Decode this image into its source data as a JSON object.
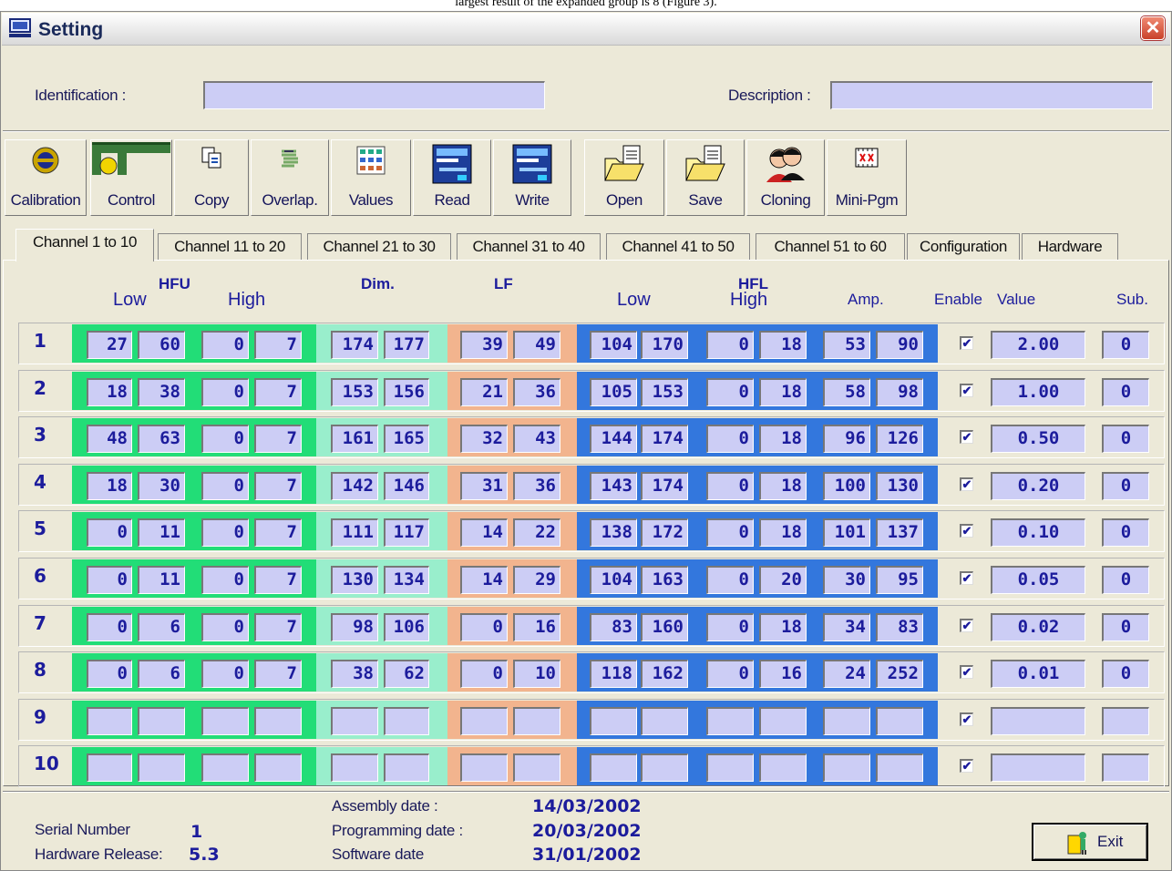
{
  "top_caption": "largest result of the expanded group is 8 (Figure 3).",
  "window": {
    "title": "Setting",
    "close_glyph": "✕"
  },
  "identification": {
    "label": "Identification :",
    "value": ""
  },
  "description": {
    "label": "Description :",
    "value": ""
  },
  "toolbar": [
    {
      "label": "Calibration",
      "icon": "calibration-icon"
    },
    {
      "label": "Control",
      "icon": "caliper-icon"
    },
    {
      "label": "Copy",
      "icon": "copy-icon"
    },
    {
      "label": "Overlap.",
      "icon": "overlap-icon"
    },
    {
      "label": "Values",
      "icon": "values-icon"
    },
    {
      "label": "Read",
      "icon": "read-icon"
    },
    {
      "label": "Write",
      "icon": "write-icon"
    },
    {
      "label": "Open",
      "icon": "open-folder-icon"
    },
    {
      "label": "Save",
      "icon": "save-folder-icon"
    },
    {
      "label": "Cloning",
      "icon": "cloning-icon"
    },
    {
      "label": "Mini-Pgm",
      "icon": "film-icon"
    }
  ],
  "tabs": [
    "Channel 1 to 10",
    "Channel 11 to 20",
    "Channel 21 to 30",
    "Channel 31 to 40",
    "Channel 41 to 50",
    "Channel 51 to 60",
    "Configuration",
    "Hardware"
  ],
  "active_tab": 0,
  "headers": {
    "hfu": "HFU",
    "hfu_low": "Low",
    "hfu_high": "High",
    "dim": "Dim.",
    "lf": "LF",
    "hfl": "HFL",
    "hfl_low": "Low",
    "hfl_high": "High",
    "amp": "Amp.",
    "enable": "Enable",
    "value": "Value",
    "sub": "Sub."
  },
  "colors": {
    "hfu": "#22dd77",
    "dim": "#99eecc",
    "lf": "#f2b48e",
    "hfl": "#3377dd",
    "field": "#cccdf5",
    "text": "#1c1c9c"
  },
  "channels": [
    {
      "n": "1",
      "hfu_low": [
        "27",
        "60"
      ],
      "hfu_high": [
        "0",
        "7"
      ],
      "dim": [
        "174",
        "177"
      ],
      "lf": [
        "39",
        "49"
      ],
      "hfl_low": [
        "104",
        "170"
      ],
      "hfl_high": [
        "0",
        "18"
      ],
      "amp": [
        "53",
        "90"
      ],
      "enabled": true,
      "value": "2.00",
      "sub": "0"
    },
    {
      "n": "2",
      "hfu_low": [
        "18",
        "38"
      ],
      "hfu_high": [
        "0",
        "7"
      ],
      "dim": [
        "153",
        "156"
      ],
      "lf": [
        "21",
        "36"
      ],
      "hfl_low": [
        "105",
        "153"
      ],
      "hfl_high": [
        "0",
        "18"
      ],
      "amp": [
        "58",
        "98"
      ],
      "enabled": true,
      "value": "1.00",
      "sub": "0"
    },
    {
      "n": "3",
      "hfu_low": [
        "48",
        "63"
      ],
      "hfu_high": [
        "0",
        "7"
      ],
      "dim": [
        "161",
        "165"
      ],
      "lf": [
        "32",
        "43"
      ],
      "hfl_low": [
        "144",
        "174"
      ],
      "hfl_high": [
        "0",
        "18"
      ],
      "amp": [
        "96",
        "126"
      ],
      "enabled": true,
      "value": "0.50",
      "sub": "0"
    },
    {
      "n": "4",
      "hfu_low": [
        "18",
        "30"
      ],
      "hfu_high": [
        "0",
        "7"
      ],
      "dim": [
        "142",
        "146"
      ],
      "lf": [
        "31",
        "36"
      ],
      "hfl_low": [
        "143",
        "174"
      ],
      "hfl_high": [
        "0",
        "18"
      ],
      "amp": [
        "100",
        "130"
      ],
      "enabled": true,
      "value": "0.20",
      "sub": "0"
    },
    {
      "n": "5",
      "hfu_low": [
        "0",
        "11"
      ],
      "hfu_high": [
        "0",
        "7"
      ],
      "dim": [
        "111",
        "117"
      ],
      "lf": [
        "14",
        "22"
      ],
      "hfl_low": [
        "138",
        "172"
      ],
      "hfl_high": [
        "0",
        "18"
      ],
      "amp": [
        "101",
        "137"
      ],
      "enabled": true,
      "value": "0.10",
      "sub": "0"
    },
    {
      "n": "6",
      "hfu_low": [
        "0",
        "11"
      ],
      "hfu_high": [
        "0",
        "7"
      ],
      "dim": [
        "130",
        "134"
      ],
      "lf": [
        "14",
        "29"
      ],
      "hfl_low": [
        "104",
        "163"
      ],
      "hfl_high": [
        "0",
        "20"
      ],
      "amp": [
        "30",
        "95"
      ],
      "enabled": true,
      "value": "0.05",
      "sub": "0"
    },
    {
      "n": "7",
      "hfu_low": [
        "0",
        "6"
      ],
      "hfu_high": [
        "0",
        "7"
      ],
      "dim": [
        "98",
        "106"
      ],
      "lf": [
        "0",
        "16"
      ],
      "hfl_low": [
        "83",
        "160"
      ],
      "hfl_high": [
        "0",
        "18"
      ],
      "amp": [
        "34",
        "83"
      ],
      "enabled": true,
      "value": "0.02",
      "sub": "0"
    },
    {
      "n": "8",
      "hfu_low": [
        "0",
        "6"
      ],
      "hfu_high": [
        "0",
        "7"
      ],
      "dim": [
        "38",
        "62"
      ],
      "lf": [
        "0",
        "10"
      ],
      "hfl_low": [
        "118",
        "162"
      ],
      "hfl_high": [
        "0",
        "16"
      ],
      "amp": [
        "24",
        "252"
      ],
      "enabled": true,
      "value": "0.01",
      "sub": "0"
    },
    {
      "n": "9",
      "hfu_low": [
        "",
        ""
      ],
      "hfu_high": [
        "",
        ""
      ],
      "dim": [
        "",
        ""
      ],
      "lf": [
        "",
        ""
      ],
      "hfl_low": [
        "",
        ""
      ],
      "hfl_high": [
        "",
        ""
      ],
      "amp": [
        "",
        ""
      ],
      "enabled": true,
      "value": "",
      "sub": ""
    },
    {
      "n": "10",
      "hfu_low": [
        "",
        ""
      ],
      "hfu_high": [
        "",
        ""
      ],
      "dim": [
        "",
        ""
      ],
      "lf": [
        "",
        ""
      ],
      "hfl_low": [
        "",
        ""
      ],
      "hfl_high": [
        "",
        ""
      ],
      "amp": [
        "",
        ""
      ],
      "enabled": true,
      "value": "",
      "sub": ""
    }
  ],
  "footer": {
    "serial_label": "Serial Number",
    "serial_value": "1",
    "hw_label": "Hardware Release:",
    "hw_value": "5.3",
    "assembly_label": "Assembly date :",
    "assembly_value": "14/03/2002",
    "programming_label": "Programming date  :",
    "programming_value": "20/03/2002",
    "software_label": "Software date",
    "software_value": "31/01/2002",
    "exit_label": "Exit"
  }
}
